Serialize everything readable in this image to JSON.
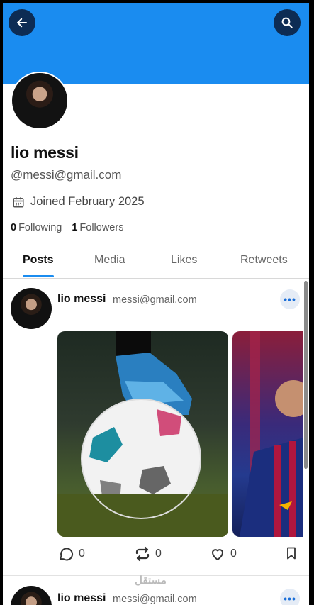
{
  "profile": {
    "name": "lio messi",
    "handle": "@messi@gmail.com",
    "joined": "Joined February 2025",
    "following_count": "0",
    "following_label": "Following",
    "followers_count": "1",
    "followers_label": "Followers"
  },
  "tabs": [
    {
      "label": "Posts",
      "active": true
    },
    {
      "label": "Media",
      "active": false
    },
    {
      "label": "Likes",
      "active": false
    },
    {
      "label": "Retweets",
      "active": false
    }
  ],
  "posts": [
    {
      "author": "lio messi",
      "handle": "messi@gmail.com",
      "more_label": "•••",
      "comments": "0",
      "retweets": "0",
      "likes": "0"
    },
    {
      "author": "lio messi",
      "handle": "messi@gmail.com",
      "more_label": "•••"
    }
  ],
  "watermark": "مستقل",
  "colors": {
    "accent": "#1a8cf0",
    "header": "#1a8cf0",
    "icon_button": "#0d2c54"
  },
  "icons": [
    "back-arrow-icon",
    "search-icon",
    "calendar-icon",
    "comment-icon",
    "retweet-icon",
    "heart-icon",
    "bookmark-icon"
  ]
}
